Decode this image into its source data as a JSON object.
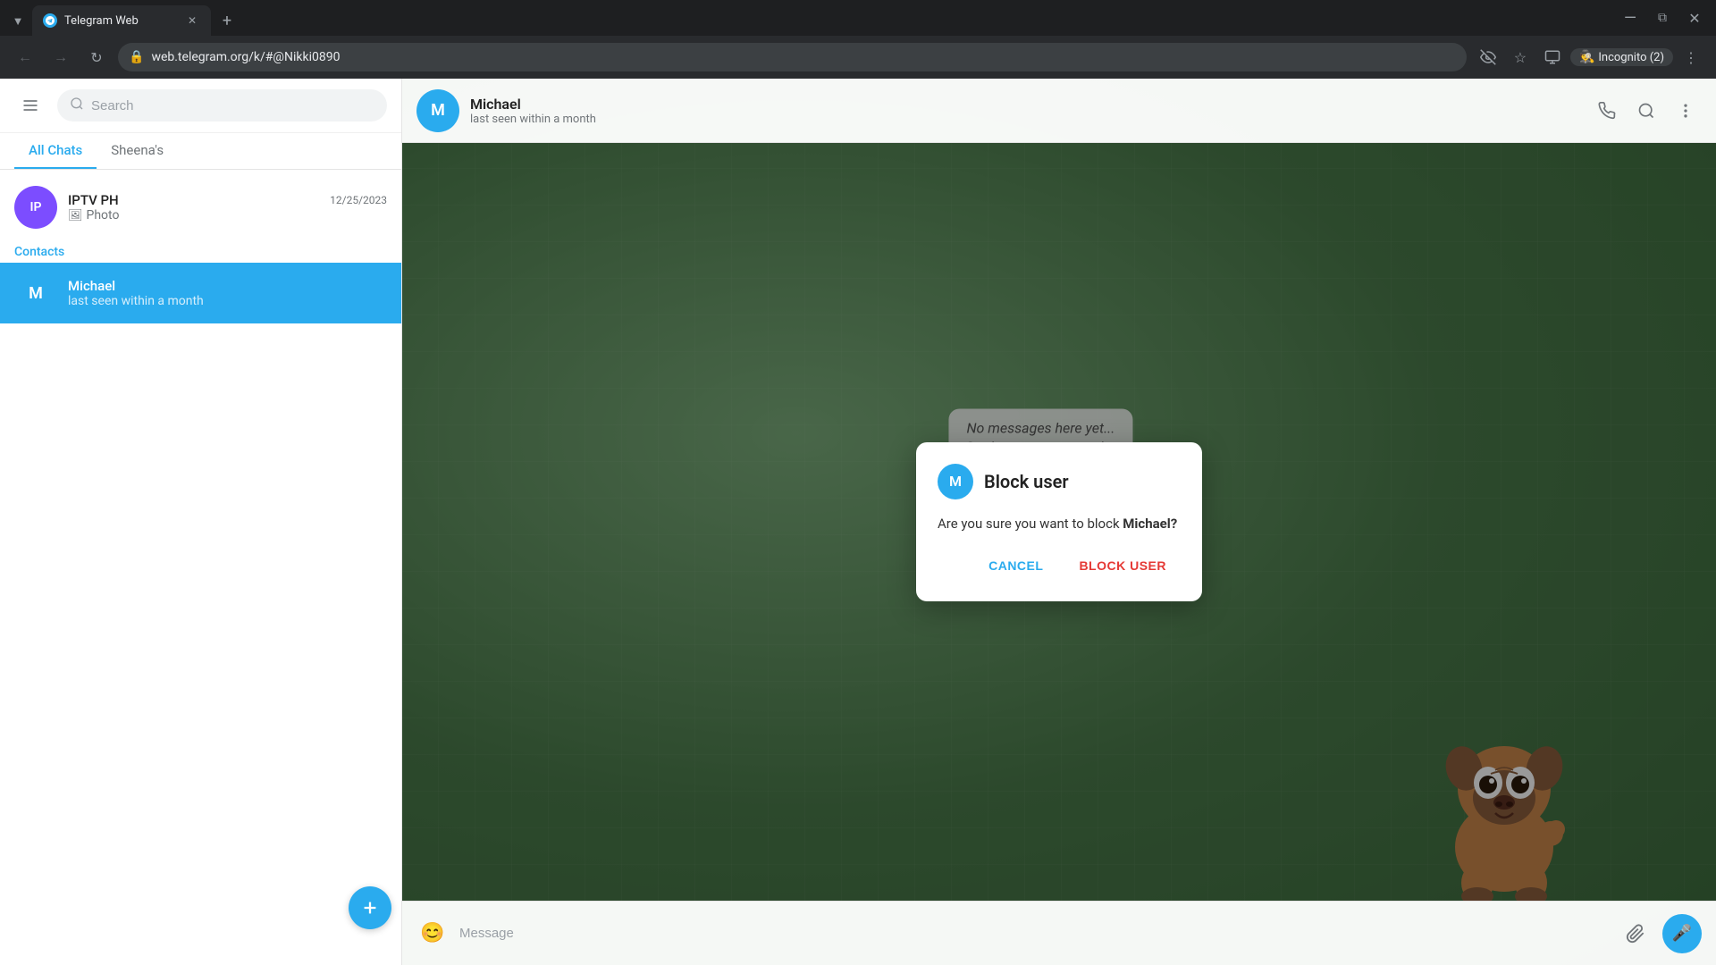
{
  "browser": {
    "tab": {
      "title": "Telegram Web",
      "favicon_color": "#2AABEE"
    },
    "url": "web.telegram.org/k/#@Nikki0890",
    "incognito_label": "Incognito (2)"
  },
  "sidebar": {
    "search_placeholder": "Search",
    "tabs": [
      {
        "label": "All Chats",
        "active": true
      },
      {
        "label": "Sheena's",
        "active": false
      }
    ],
    "chats": [
      {
        "id": "iptv-ph",
        "name": "IPTV PH",
        "preview": "Photo",
        "time": "12/25/2023",
        "avatar_text": "IP",
        "avatar_color": "#7C4DFF",
        "has_photo": true
      }
    ],
    "contacts_label": "Contacts",
    "contacts": [
      {
        "id": "michael",
        "name": "Michael",
        "status": "last seen within a month",
        "avatar_text": "M",
        "avatar_color": "#2AABEE",
        "active": true
      }
    ],
    "fab_label": "✎"
  },
  "chat_header": {
    "name": "Michael",
    "status": "last seen within a month",
    "avatar_text": "M",
    "avatar_color": "#2AABEE"
  },
  "empty_state": {
    "title": "No messages here yet...",
    "subtitle": "Send a message or tap the",
    "subtitle2": "greeting below."
  },
  "chat_input": {
    "placeholder": "Message"
  },
  "dialog": {
    "title": "Block user",
    "avatar_text": "M",
    "avatar_color": "#2AABEE",
    "body_part1": "Are you sure you want to block",
    "body_name": "Michael?",
    "cancel_label": "CANCEL",
    "confirm_label": "BLOCK USER"
  }
}
